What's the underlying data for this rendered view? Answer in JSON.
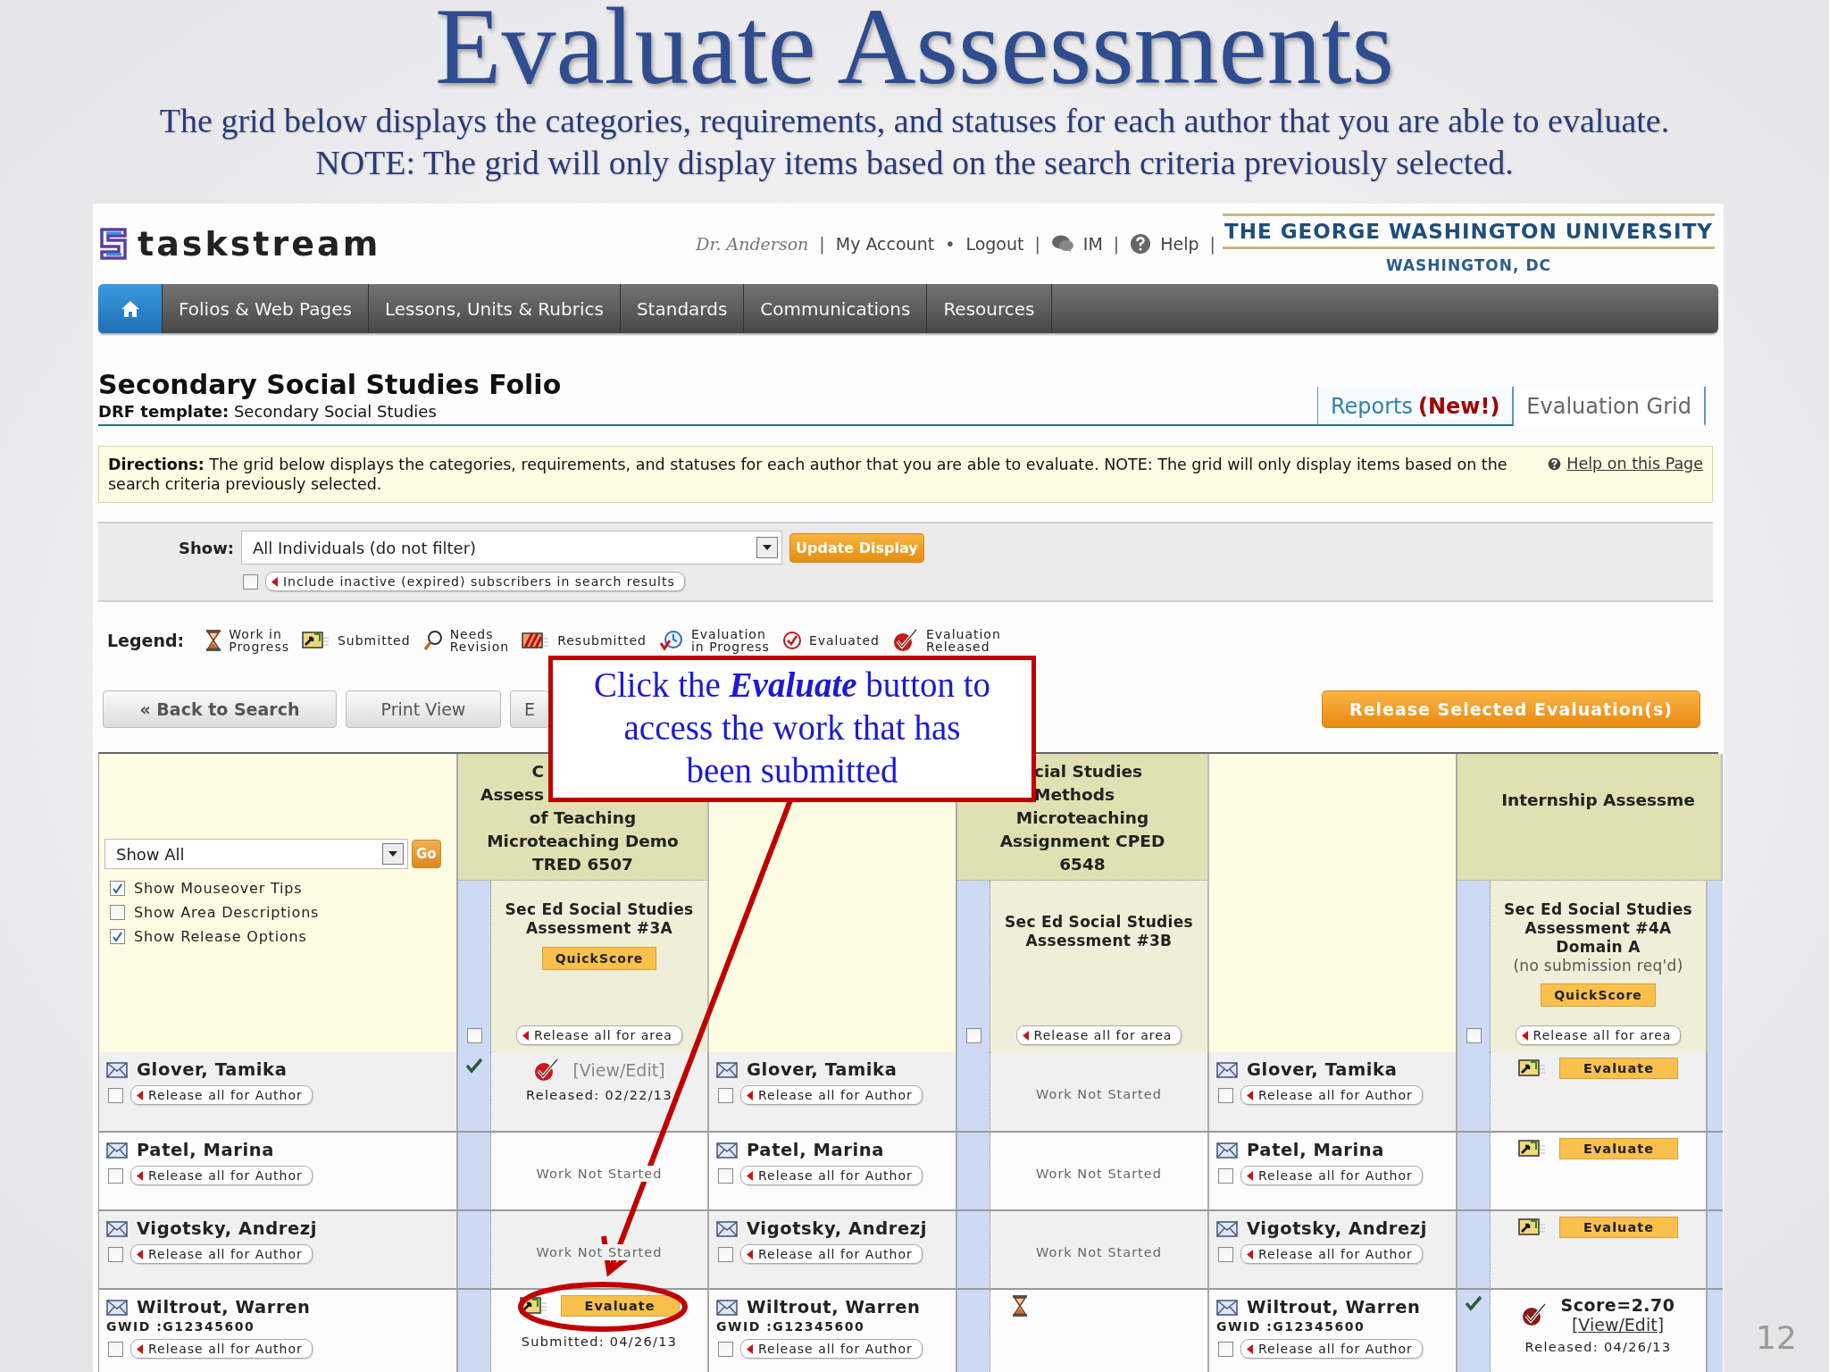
{
  "slide": {
    "title": "Evaluate Assessments",
    "subtitle": "The grid below displays the categories, requirements, and statuses for each author that you are able to evaluate. NOTE: The grid will only display items based on the search criteria previously selected.",
    "page_number": "12"
  },
  "header": {
    "logo": "taskstream",
    "user_links": [
      {
        "label": "Dr. Anderson",
        "kind": "user",
        "sep": "|"
      },
      {
        "label": "My Account",
        "kind": "link",
        "sep": "•"
      },
      {
        "label": "Logout",
        "kind": "link",
        "sep": "|"
      },
      {
        "label": "IM",
        "kind": "im",
        "sep": "|"
      },
      {
        "label": "Help",
        "kind": "help",
        "sep": "|"
      }
    ],
    "university": {
      "name": "THE GEORGE WASHINGTON UNIVERSITY",
      "place": "WASHINGTON, DC"
    }
  },
  "nav": [
    {
      "kind": "home",
      "selected": true
    },
    {
      "kind": "link",
      "label": "Folios & Web Pages",
      "selected": false
    },
    {
      "kind": "link",
      "label": "Lessons, Units & Rubrics",
      "selected": false
    },
    {
      "kind": "link",
      "label": "Standards",
      "selected": false
    },
    {
      "kind": "link",
      "label": "Communications",
      "selected": false
    },
    {
      "kind": "link",
      "label": "Resources",
      "selected": false
    }
  ],
  "folio": {
    "title": "Secondary Social Studies Folio",
    "template_label": "DRF template:",
    "template": "Secondary Social Studies"
  },
  "tabs": [
    {
      "label": "Reports",
      "badge": "(New!)",
      "selected": false
    },
    {
      "label": "Evaluation Grid",
      "selected": true
    }
  ],
  "directions": {
    "text": "**Directions:** The grid below displays the categories, requirements, and statuses for each author that you are able to evaluate. NOTE: The grid will only display items based on the search criteria previously selected.",
    "help_link": "Help on this Page"
  },
  "filter": {
    "label": "Show:",
    "select": "All Individuals (do not filter)",
    "button": "Update Display",
    "include_inactive": {
      "checked": false,
      "label": "Include inactive (expired) subscribers in search results"
    }
  },
  "legend": {
    "label": "Legend:",
    "items": [
      {
        "kind": "hourglass",
        "lines": [
          "Work in",
          "Progress"
        ]
      },
      {
        "kind": "submitted",
        "lines": [
          "Submitted"
        ]
      },
      {
        "kind": "magnifier",
        "lines": [
          "Needs",
          "Revision"
        ]
      },
      {
        "kind": "resubmitted",
        "lines": [
          "Resubmitted"
        ]
      },
      {
        "kind": "clock",
        "lines": [
          "Evaluation",
          "in Progress"
        ]
      },
      {
        "kind": "check_circle",
        "lines": [
          "Evaluated"
        ]
      },
      {
        "kind": "released",
        "lines": [
          "Evaluation",
          "Released"
        ]
      }
    ]
  },
  "toolbar": {
    "buttons": [
      "« Back to Search",
      "Print View",
      "E"
    ],
    "release_button": "Release Selected Evaluation(s)"
  },
  "grid": {
    "controls": {
      "select": "Show All",
      "go": "Go",
      "options": [
        {
          "label": "Show Mouseover Tips",
          "checked": true
        },
        {
          "label": "Show Area Descriptions",
          "checked": false
        },
        {
          "label": "Show Release Options",
          "checked": true
        }
      ]
    },
    "groups": [
      {
        "kind": "cut_right",
        "cut_lines": [
          "C",
          "Assess"
        ],
        "lines": [
          "of Teaching",
          "Microteaching Demo",
          "TRED 6507"
        ],
        "area": {
          "checked": false,
          "title": "Sec Ed Social Studies Assessment #3A",
          "quickscore": "QuickScore",
          "release": "Release all for area"
        }
      },
      {
        "kind": "cut_left",
        "cut_lines": [
          "cial Studies",
          "Methods"
        ],
        "lines": [
          "Microteaching",
          "Assignment CPED",
          "6548"
        ],
        "area": {
          "checked": false,
          "title": "Sec Ed Social Studies Assessment #3B",
          "release": "Release all for area"
        }
      },
      {
        "kind": "plain",
        "lines": [
          "Internship Assessme"
        ],
        "area": {
          "checked": false,
          "title": "Sec Ed Social Studies Assessment #4A Domain A",
          "note": "(no submission req'd)",
          "quickscore": "QuickScore",
          "release": "Release all for area"
        }
      }
    ],
    "rows": [
      {
        "authors": [
          {
            "name": "Glover, Tamika",
            "checked": false,
            "release": "Release all for Author"
          },
          {
            "name": "Glover, Tamika",
            "checked": false,
            "release": "Release all for Author"
          },
          {
            "name": "Glover, Tamika",
            "checked": false,
            "release": "Release all for Author"
          }
        ],
        "statuses": [
          {
            "kind": "released",
            "marked": true,
            "link": "[View/Edit]",
            "date": "Released: 02/22/13"
          },
          {
            "kind": "not_started",
            "marked": false,
            "text": "Work Not Started"
          },
          {
            "kind": "evaluate",
            "marked": false,
            "button": "Evaluate"
          }
        ]
      },
      {
        "authors": [
          {
            "name": "Patel, Marina",
            "checked": false,
            "release": "Release all for Author"
          },
          {
            "name": "Patel, Marina",
            "checked": false,
            "release": "Release all for Author"
          },
          {
            "name": "Patel, Marina",
            "checked": false,
            "release": "Release all for Author"
          }
        ],
        "statuses": [
          {
            "kind": "not_started",
            "marked": false,
            "text": "Work Not Started"
          },
          {
            "kind": "not_started",
            "marked": false,
            "text": "Work Not Started"
          },
          {
            "kind": "evaluate",
            "marked": false,
            "button": "Evaluate"
          }
        ]
      },
      {
        "authors": [
          {
            "name": "Vigotsky, Andrezj",
            "checked": false,
            "release": "Release all for Author"
          },
          {
            "name": "Vigotsky, Andrezj",
            "checked": false,
            "release": "Release all for Author"
          },
          {
            "name": "Vigotsky, Andrezj",
            "checked": false,
            "release": "Release all for Author"
          }
        ],
        "statuses": [
          {
            "kind": "not_started",
            "marked": false,
            "text": "Work Not Started"
          },
          {
            "kind": "not_started",
            "marked": false,
            "text": "Work Not Started"
          },
          {
            "kind": "evaluate",
            "marked": false,
            "button": "Evaluate"
          }
        ]
      },
      {
        "authors": [
          {
            "name": "Wiltrout, Warren",
            "gwid": "GWID :G12345600",
            "checked": false,
            "release": "Release all for Author"
          },
          {
            "name": "Wiltrout, Warren",
            "gwid": "GWID :G12345600",
            "checked": false,
            "release": "Release all for Author"
          },
          {
            "name": "Wiltrout, Warren",
            "gwid": "GWID :G12345600",
            "checked": false,
            "release": "Release all for Author"
          }
        ],
        "statuses": [
          {
            "kind": "evaluate",
            "marked": false,
            "button": "Evaluate",
            "date": "Submitted: 04/26/13"
          },
          {
            "kind": "in_progress",
            "marked": false
          },
          {
            "kind": "score",
            "marked": true,
            "score": "Score=2.70",
            "link": "[View/Edit]",
            "date": "Released: 04/26/13"
          }
        ]
      }
    ]
  },
  "callout": {
    "text": "Click the *Evaluate* button to access the work that has been submitted"
  }
}
